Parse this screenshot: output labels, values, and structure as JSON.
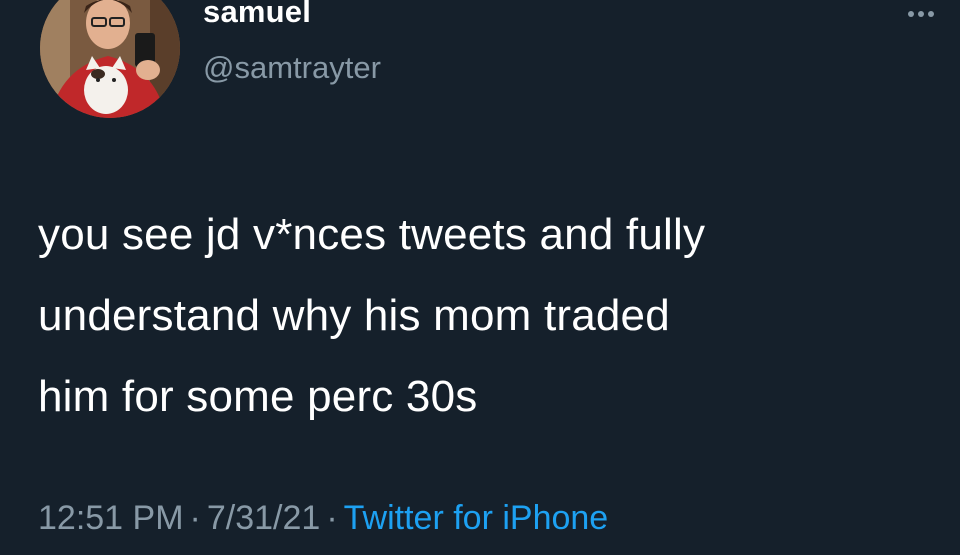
{
  "user": {
    "display_name": "samuel",
    "handle": "@samtrayter"
  },
  "tweet": {
    "lines": [
      "you see jd v*nces tweets and fully",
      "understand why his mom traded",
      "him for some perc 30s"
    ]
  },
  "meta": {
    "time": "12:51 PM",
    "separator": "·",
    "date": "7/31/21",
    "source": "Twitter for iPhone"
  },
  "colors": {
    "background": "#15202b",
    "text": "#ffffff",
    "muted": "#8899a6",
    "link": "#1da1f2"
  },
  "icons": {
    "more": "more-horizontal-icon"
  }
}
